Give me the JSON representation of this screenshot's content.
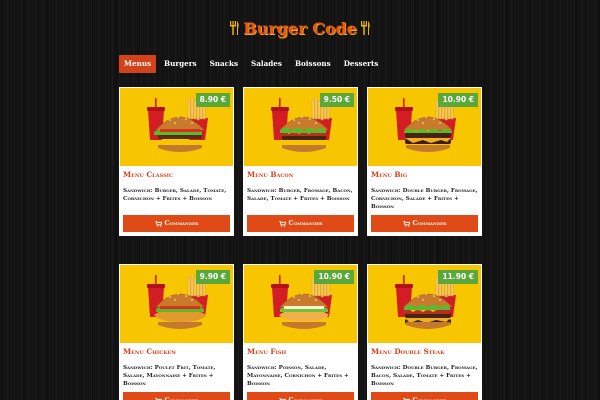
{
  "brand": {
    "title": "Burger Code",
    "utensil_glyph": "🍴"
  },
  "nav": {
    "items": [
      {
        "label": "Menus",
        "active": true
      },
      {
        "label": "Burgers",
        "active": false
      },
      {
        "label": "Snacks",
        "active": false
      },
      {
        "label": "Salades",
        "active": false
      },
      {
        "label": "Boissons",
        "active": false
      },
      {
        "label": "Desserts",
        "active": false
      }
    ]
  },
  "cards": [
    {
      "name": "Menu Classic",
      "price": "8.90 €",
      "desc": "Sandwich: Burger, Salade, Tomate, Cornichon + Frites + Boisson",
      "button": "Commander",
      "filling": "classic"
    },
    {
      "name": "Menu Bacon",
      "price": "9.50 €",
      "desc": "Sandwich: Burger, Fromage, Bacon, Salade, Tomate + Frites + Boisson",
      "button": "Commander",
      "filling": "bacon"
    },
    {
      "name": "Menu Big",
      "price": "10.90 €",
      "desc": "Sandwich: Double Burger, Fromage, Cornichon, Salade + Frites + Boisson",
      "button": "Commander",
      "filling": "big"
    },
    {
      "name": "Menu Chicken",
      "price": "9.90 €",
      "desc": "Sandwich: Poulet Frit, Tomate, Salade, Mayonnaise + Frites + Boisson",
      "button": "Commander",
      "filling": "chicken"
    },
    {
      "name": "Menu Fish",
      "price": "10.90 €",
      "desc": "Sandwich: Poisson, Salade, Mayonnaise, Cornichon + Frites + Boisson",
      "button": "Commander",
      "filling": "fish"
    },
    {
      "name": "Menu Double Steak",
      "price": "11.90 €",
      "desc": "Sandwich: Double Burger, Fromage, Bacon, Salade, Tomate + Frites + Boisson",
      "button": "Commander",
      "filling": "double"
    }
  ],
  "colors": {
    "accent": "#d4421b",
    "price_badge": "#5aa83a",
    "card_image_bg": "#f7c600"
  }
}
